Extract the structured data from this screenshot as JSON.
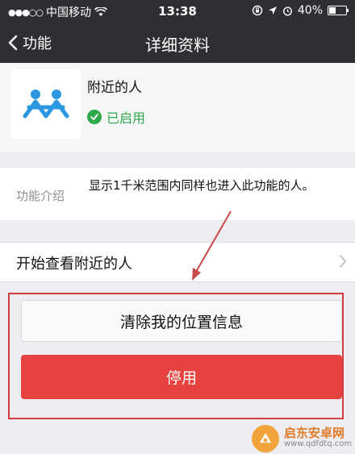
{
  "status_bar": {
    "carrier": "中国移动",
    "time": "13:38",
    "battery": "40%",
    "signal_icon": "signal-dots-icon",
    "wifi_icon": "wifi-icon",
    "lock_icon": "rotation-lock-icon",
    "location_icon": "location-arrow-icon",
    "alarm_icon": "alarm-icon",
    "battery_icon": "battery-icon"
  },
  "nav": {
    "back_label": "功能",
    "title": "详细资料"
  },
  "feature": {
    "name": "附近的人",
    "status": "已启用",
    "icon": "people-nearby-icon",
    "icon_color": "#2a97e0",
    "status_color": "#2fa84a"
  },
  "intro": {
    "label": "功能介绍",
    "text": "显示1千米范围内同样也进入此功能的人。"
  },
  "view_row": {
    "label": "开始查看附近的人"
  },
  "buttons": {
    "clear_location": "清除我的位置信息",
    "disable": "停用",
    "disable_color": "#e64340"
  },
  "watermark": {
    "brand": "启东安卓网",
    "url": "www.qdfdtq.com"
  }
}
